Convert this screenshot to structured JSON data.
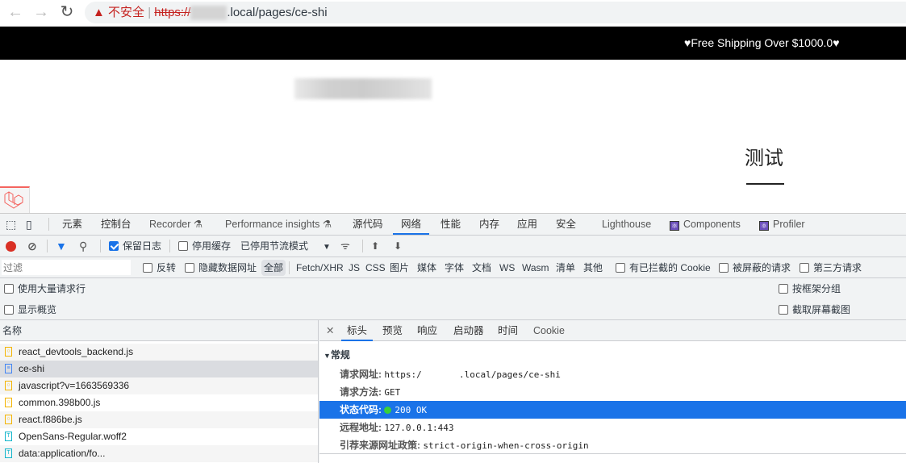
{
  "browser": {
    "security_label": "不安全",
    "url_scheme": "https://",
    "url_rest": ".local/pages/ce-shi"
  },
  "page": {
    "promo_text": "♥Free Shipping Over $1000.0♥",
    "heading": "测试"
  },
  "devtools": {
    "tabs": [
      "元素",
      "控制台",
      "Recorder ⚗",
      "Performance insights ⚗",
      "源代码",
      "网络",
      "性能",
      "内存",
      "应用",
      "安全",
      "Lighthouse",
      "Components",
      "Profiler"
    ],
    "active_tab": "网络",
    "toolbar": {
      "preserve_log": "保留日志",
      "disable_cache": "停用缓存",
      "throttling": "已停用节流模式"
    },
    "filter": {
      "placeholder": "过滤",
      "invert": "反转",
      "hide_data_urls": "隐藏数据网址",
      "types": [
        "全部",
        "Fetch/XHR",
        "JS",
        "CSS",
        "图片",
        "媒体",
        "字体",
        "文档",
        "WS",
        "Wasm",
        "清单",
        "其他"
      ],
      "blocked_cookies": "有已拦截的 Cookie",
      "blocked_requests": "被屏蔽的请求",
      "third_party": "第三方请求"
    },
    "options": {
      "large_rows": "使用大量请求行",
      "overview": "显示概览",
      "group_by_frame": "按框架分组",
      "screenshots": "截取屏幕截图"
    },
    "requests_header": "名称",
    "requests": [
      {
        "name": "react_devtools_backend.js",
        "type": "js"
      },
      {
        "name": "ce-shi",
        "type": "doc"
      },
      {
        "name": "javascript?v=1663569336",
        "type": "js"
      },
      {
        "name": "common.398b00.js",
        "type": "js"
      },
      {
        "name": "react.f886be.js",
        "type": "js"
      },
      {
        "name": "OpenSans-Regular.woff2",
        "type": "font"
      },
      {
        "name": "data:application/fo...",
        "type": "font"
      }
    ],
    "detail_tabs": [
      "标头",
      "预览",
      "响应",
      "启动器",
      "时间",
      "Cookie"
    ],
    "section": "常规",
    "general": [
      {
        "k": "请求网址:",
        "v": "https:/       .local/pages/ce-shi"
      },
      {
        "k": "请求方法:",
        "v": "GET"
      },
      {
        "k": "状态代码:",
        "v": "200 OK"
      },
      {
        "k": "远程地址:",
        "v": "127.0.0.1:443"
      },
      {
        "k": "引荐来源网址政策:",
        "v": "strict-origin-when-cross-origin"
      }
    ]
  }
}
